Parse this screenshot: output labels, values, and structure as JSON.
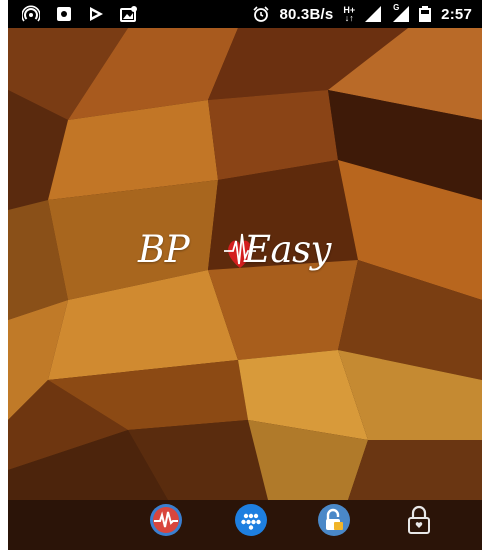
{
  "status_bar": {
    "network_speed": "80.3B/s",
    "network_type": "H+",
    "signal_label": "G",
    "time": "2:57",
    "icons": [
      "hotspot-icon",
      "screenshot-icon",
      "play-store-icon",
      "gallery-notification-icon",
      "alarm-icon",
      "signal-icon",
      "signal-icon",
      "battery-icon"
    ]
  },
  "splash": {
    "logo_left": "BP",
    "logo_right": "Easy",
    "logo_accent_color": "#d41f1f",
    "heart_icon": "heart-pulse-icon"
  },
  "dock": {
    "apps": [
      {
        "name": "bp-app",
        "icon": "heart-pulse-icon",
        "color": "#d9463d"
      },
      {
        "name": "app-launcher",
        "icon": "app-drawer-icon",
        "color": "#1e7fe0"
      },
      {
        "name": "app-lock-folder",
        "icon": "lock-folder-icon",
        "color": "#4a88c8"
      },
      {
        "name": "lock",
        "icon": "padlock-icon",
        "color": "#d8d8d8"
      }
    ]
  },
  "colors": {
    "background_dark": "#3a1d0a",
    "background_light": "#c67a2a",
    "status_bar": "#000000"
  }
}
